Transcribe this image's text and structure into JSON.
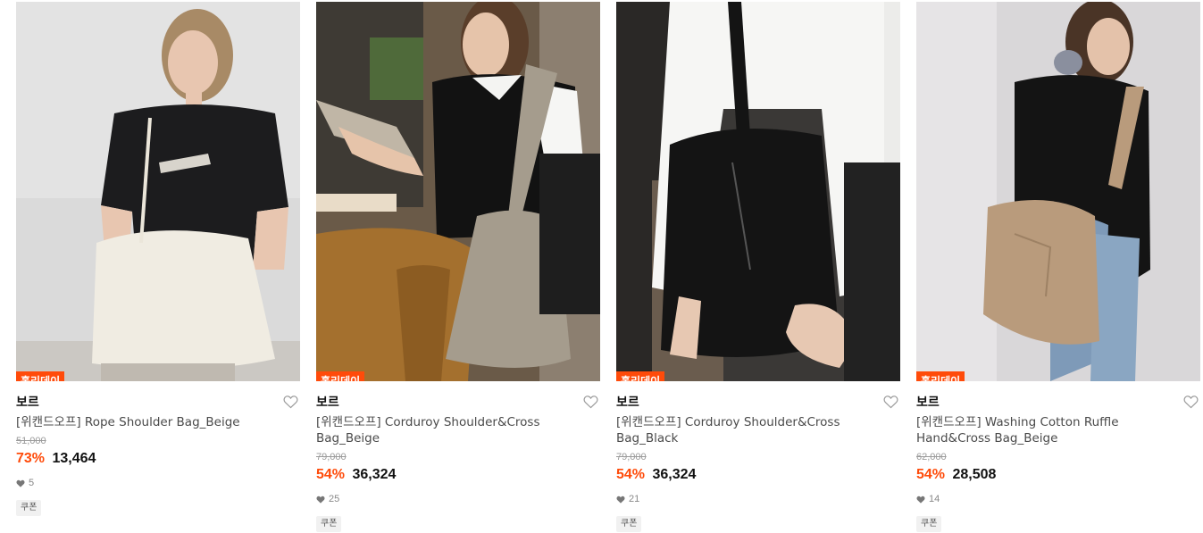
{
  "products": [
    {
      "badge": "홀리데이",
      "brand": "보르",
      "name": "[위캔드오프] Rope Shoulder Bag_Beige",
      "original_price": "51,000",
      "discount_rate": "73%",
      "price": "13,464",
      "likes": "5",
      "coupon": "쿠폰",
      "image": {
        "bg": "#dcdcdc",
        "shirt": "#1c1c1e",
        "bag": "#f0ece2",
        "skin": "#e8c6b0",
        "hair": "#a88a66"
      }
    },
    {
      "badge": "홀리데이",
      "brand": "보르",
      "name": "[위캔드오프] Corduroy Shoulder&Cross Bag_Beige",
      "original_price": "79,000",
      "discount_rate": "54%",
      "price": "36,324",
      "likes": "25",
      "coupon": "쿠폰",
      "image": {
        "bg": "#6a5a48",
        "shirt": "#121212",
        "bag": "#a59c8d",
        "skin": "#e6c4aa",
        "hair": "#5a3e2a"
      }
    },
    {
      "badge": "홀리데이",
      "brand": "보르",
      "name": "[위캔드오프] Corduroy Shoulder&Cross Bag_Black",
      "original_price": "79,000",
      "discount_rate": "54%",
      "price": "36,324",
      "likes": "21",
      "coupon": "쿠폰",
      "image": {
        "bg": "#3a3836",
        "shirt": "#f6f6f4",
        "bag": "#141414",
        "skin": "#e7c8b2",
        "hair": "#6a4c34"
      }
    },
    {
      "badge": "홀리데이",
      "brand": "보르",
      "name": "[위캔드오프] Washing Cotton Ruffle Hand&Cross Bag_Beige",
      "original_price": "62,000",
      "discount_rate": "54%",
      "price": "28,508",
      "likes": "14",
      "coupon": "쿠폰",
      "image": {
        "bg": "#d9d7d9",
        "shirt": "#141414",
        "bag": "#b99b7c",
        "skin": "#e4c2aa",
        "hair": "#4a3426"
      }
    }
  ],
  "colors": {
    "accent": "#ff4b0a",
    "text": "#111111",
    "muted": "#9a9a9a"
  }
}
